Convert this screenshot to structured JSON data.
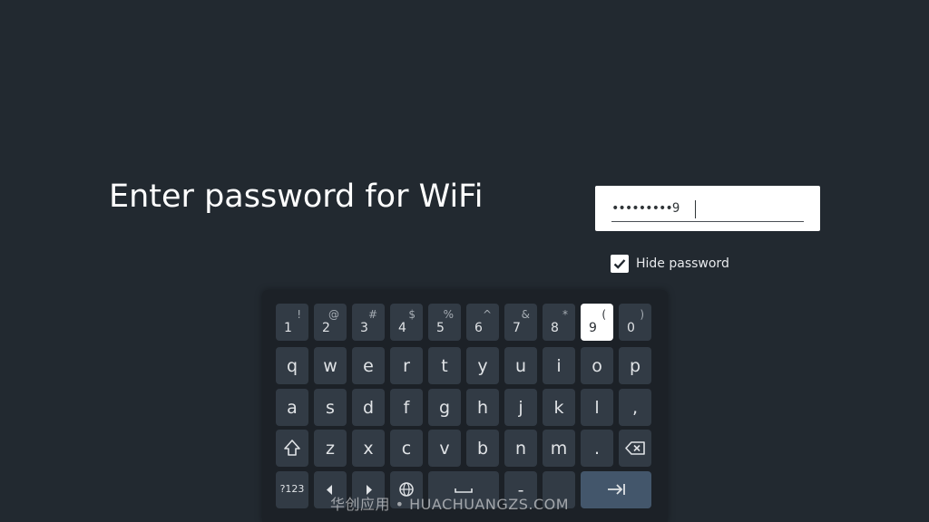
{
  "title": "Enter password for WiFi",
  "password": {
    "masked_value": "•••••••••9",
    "hide_password_label": "Hide password",
    "hide_password_checked": true
  },
  "keyboard": {
    "row1": [
      {
        "num": "1",
        "sym": "!"
      },
      {
        "num": "2",
        "sym": "@"
      },
      {
        "num": "3",
        "sym": "#"
      },
      {
        "num": "4",
        "sym": "$"
      },
      {
        "num": "5",
        "sym": "%"
      },
      {
        "num": "6",
        "sym": "^"
      },
      {
        "num": "7",
        "sym": "&"
      },
      {
        "num": "8",
        "sym": "*"
      },
      {
        "num": "9",
        "sym": "("
      },
      {
        "num": "0",
        "sym": ")"
      }
    ],
    "row2": [
      "q",
      "w",
      "e",
      "r",
      "t",
      "y",
      "u",
      "i",
      "o",
      "p"
    ],
    "row3": [
      "a",
      "s",
      "d",
      "f",
      "g",
      "h",
      "j",
      "k",
      "l",
      ","
    ],
    "row4": [
      "z",
      "x",
      "c",
      "v",
      "b",
      "n",
      "m",
      "."
    ],
    "symbols_key_label": "?123",
    "dash_label": "-",
    "focused_key": "9",
    "enter_color": "#43566b",
    "key_color": "#323b45"
  },
  "icons": {
    "shift": "shift-icon",
    "backspace": "backspace-icon",
    "globe": "globe-icon",
    "space": "space-icon",
    "enter": "tab-arrow-icon",
    "left": "arrow-left-icon",
    "right": "arrow-right-icon"
  },
  "watermark": "华创应用 • HUACHUANGZS.COM"
}
